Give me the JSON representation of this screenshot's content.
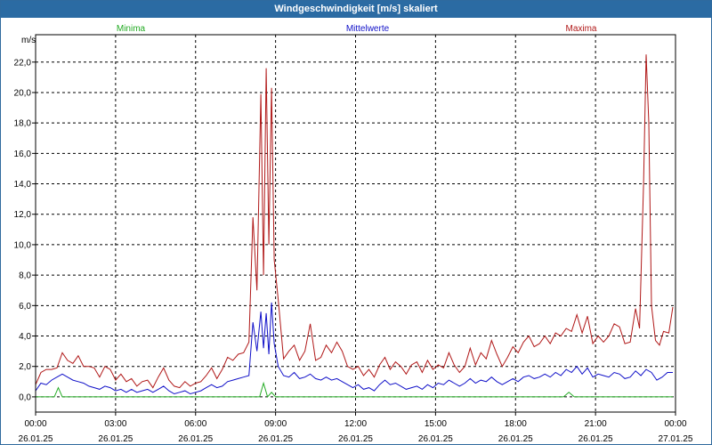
{
  "window": {
    "title": "Windgeschwindigkeit [m/s] skaliert"
  },
  "chart_data": {
    "type": "line",
    "title": "Windgeschwindigkeit [m/s] skaliert",
    "ylabel": "m/s",
    "xlabel": "",
    "ylim": [
      -1.0,
      23.8
    ],
    "xlim": [
      0,
      24
    ],
    "y_ticks": [
      "0,0",
      "2,0",
      "4,0",
      "6,0",
      "8,0",
      "10,0",
      "12,0",
      "14,0",
      "16,0",
      "18,0",
      "20,0",
      "22,0"
    ],
    "x_ticks": [
      {
        "time": "00:00",
        "date": "26.01.25"
      },
      {
        "time": "03:00",
        "date": "26.01.25"
      },
      {
        "time": "06:00",
        "date": "26.01.25"
      },
      {
        "time": "09:00",
        "date": "26.01.25"
      },
      {
        "time": "12:00",
        "date": "26.01.25"
      },
      {
        "time": "15:00",
        "date": "26.01.25"
      },
      {
        "time": "18:00",
        "date": "26.01.25"
      },
      {
        "time": "21:00",
        "date": "26.01.25"
      },
      {
        "time": "00:00",
        "date": "27.01.25"
      }
    ],
    "grid": true,
    "legend_position": "top",
    "colors": {
      "minima": "#22aa22",
      "mittel": "#1010c8",
      "maxima": "#b01818",
      "grid": "#000000"
    },
    "series": [
      {
        "name": "Maxima",
        "color": "#b01818",
        "points": [
          [
            0.0,
            0.8
          ],
          [
            0.2,
            1.6
          ],
          [
            0.4,
            1.8
          ],
          [
            0.6,
            1.8
          ],
          [
            0.8,
            1.9
          ],
          [
            1.0,
            2.9
          ],
          [
            1.2,
            2.4
          ],
          [
            1.4,
            2.2
          ],
          [
            1.6,
            2.7
          ],
          [
            1.8,
            2.0
          ],
          [
            2.0,
            2.0
          ],
          [
            2.2,
            1.9
          ],
          [
            2.4,
            1.3
          ],
          [
            2.6,
            2.0
          ],
          [
            2.8,
            1.8
          ],
          [
            3.0,
            1.1
          ],
          [
            3.2,
            1.5
          ],
          [
            3.4,
            1.0
          ],
          [
            3.6,
            1.2
          ],
          [
            3.8,
            0.7
          ],
          [
            4.0,
            1.0
          ],
          [
            4.2,
            1.1
          ],
          [
            4.4,
            0.6
          ],
          [
            4.6,
            1.3
          ],
          [
            4.8,
            1.9
          ],
          [
            5.0,
            1.1
          ],
          [
            5.2,
            0.7
          ],
          [
            5.4,
            0.6
          ],
          [
            5.6,
            1.0
          ],
          [
            5.8,
            0.7
          ],
          [
            6.0,
            0.9
          ],
          [
            6.2,
            1.0
          ],
          [
            6.4,
            1.4
          ],
          [
            6.6,
            1.9
          ],
          [
            6.8,
            1.2
          ],
          [
            7.0,
            1.8
          ],
          [
            7.2,
            2.6
          ],
          [
            7.4,
            2.4
          ],
          [
            7.6,
            2.8
          ],
          [
            7.8,
            2.9
          ],
          [
            8.0,
            3.6
          ],
          [
            8.15,
            11.8
          ],
          [
            8.3,
            7.0
          ],
          [
            8.45,
            19.9
          ],
          [
            8.55,
            8.0
          ],
          [
            8.65,
            21.6
          ],
          [
            8.75,
            10.0
          ],
          [
            8.85,
            20.3
          ],
          [
            8.95,
            9.0
          ],
          [
            9.1,
            6.4
          ],
          [
            9.3,
            2.5
          ],
          [
            9.5,
            3.0
          ],
          [
            9.7,
            3.4
          ],
          [
            9.9,
            2.4
          ],
          [
            10.1,
            3.0
          ],
          [
            10.3,
            4.8
          ],
          [
            10.5,
            2.4
          ],
          [
            10.7,
            2.6
          ],
          [
            10.9,
            3.4
          ],
          [
            11.1,
            2.9
          ],
          [
            11.3,
            3.6
          ],
          [
            11.5,
            3.0
          ],
          [
            11.7,
            2.0
          ],
          [
            11.9,
            1.8
          ],
          [
            12.1,
            2.0
          ],
          [
            12.3,
            1.4
          ],
          [
            12.5,
            1.8
          ],
          [
            12.7,
            1.3
          ],
          [
            12.9,
            2.1
          ],
          [
            13.1,
            2.6
          ],
          [
            13.3,
            1.8
          ],
          [
            13.5,
            2.3
          ],
          [
            13.7,
            2.0
          ],
          [
            13.9,
            1.5
          ],
          [
            14.1,
            2.1
          ],
          [
            14.3,
            2.3
          ],
          [
            14.5,
            1.6
          ],
          [
            14.7,
            2.4
          ],
          [
            14.9,
            1.8
          ],
          [
            15.1,
            2.1
          ],
          [
            15.3,
            1.9
          ],
          [
            15.5,
            2.9
          ],
          [
            15.7,
            2.1
          ],
          [
            15.9,
            1.6
          ],
          [
            16.1,
            2.0
          ],
          [
            16.3,
            3.2
          ],
          [
            16.5,
            2.1
          ],
          [
            16.7,
            2.9
          ],
          [
            16.9,
            2.5
          ],
          [
            17.1,
            3.7
          ],
          [
            17.3,
            2.8
          ],
          [
            17.5,
            2.0
          ],
          [
            17.7,
            2.6
          ],
          [
            17.9,
            3.3
          ],
          [
            18.1,
            2.9
          ],
          [
            18.3,
            3.6
          ],
          [
            18.5,
            4.0
          ],
          [
            18.7,
            3.3
          ],
          [
            18.9,
            3.5
          ],
          [
            19.1,
            4.0
          ],
          [
            19.3,
            3.5
          ],
          [
            19.5,
            4.2
          ],
          [
            19.7,
            4.0
          ],
          [
            19.9,
            4.5
          ],
          [
            20.1,
            4.3
          ],
          [
            20.3,
            5.4
          ],
          [
            20.5,
            4.2
          ],
          [
            20.7,
            5.3
          ],
          [
            20.9,
            3.5
          ],
          [
            21.1,
            4.0
          ],
          [
            21.3,
            3.6
          ],
          [
            21.5,
            4.0
          ],
          [
            21.7,
            4.8
          ],
          [
            21.9,
            4.6
          ],
          [
            22.1,
            3.5
          ],
          [
            22.3,
            3.6
          ],
          [
            22.5,
            5.8
          ],
          [
            22.65,
            4.5
          ],
          [
            22.8,
            14.0
          ],
          [
            22.9,
            22.5
          ],
          [
            23.0,
            18.0
          ],
          [
            23.1,
            6.0
          ],
          [
            23.25,
            3.7
          ],
          [
            23.4,
            3.4
          ],
          [
            23.55,
            4.3
          ],
          [
            23.75,
            4.2
          ],
          [
            23.9,
            5.9
          ]
        ]
      },
      {
        "name": "Mittelwerte",
        "color": "#1010c8",
        "points": [
          [
            0.0,
            0.4
          ],
          [
            0.2,
            0.9
          ],
          [
            0.4,
            0.8
          ],
          [
            0.6,
            1.1
          ],
          [
            0.8,
            1.3
          ],
          [
            1.0,
            1.5
          ],
          [
            1.2,
            1.3
          ],
          [
            1.4,
            1.1
          ],
          [
            1.6,
            1.0
          ],
          [
            1.8,
            0.9
          ],
          [
            2.0,
            0.7
          ],
          [
            2.2,
            0.6
          ],
          [
            2.4,
            0.5
          ],
          [
            2.6,
            0.7
          ],
          [
            2.8,
            0.6
          ],
          [
            3.0,
            0.4
          ],
          [
            3.2,
            0.5
          ],
          [
            3.4,
            0.3
          ],
          [
            3.6,
            0.5
          ],
          [
            3.8,
            0.3
          ],
          [
            4.0,
            0.4
          ],
          [
            4.2,
            0.5
          ],
          [
            4.4,
            0.3
          ],
          [
            4.6,
            0.5
          ],
          [
            4.8,
            0.7
          ],
          [
            5.0,
            0.4
          ],
          [
            5.2,
            0.2
          ],
          [
            5.4,
            0.3
          ],
          [
            5.6,
            0.4
          ],
          [
            5.8,
            0.2
          ],
          [
            6.0,
            0.3
          ],
          [
            6.2,
            0.4
          ],
          [
            6.4,
            0.6
          ],
          [
            6.6,
            0.8
          ],
          [
            6.8,
            0.6
          ],
          [
            7.0,
            0.7
          ],
          [
            7.2,
            1.0
          ],
          [
            7.4,
            1.1
          ],
          [
            7.6,
            1.2
          ],
          [
            7.8,
            1.3
          ],
          [
            8.0,
            1.4
          ],
          [
            8.15,
            4.9
          ],
          [
            8.3,
            3.0
          ],
          [
            8.45,
            5.6
          ],
          [
            8.55,
            3.2
          ],
          [
            8.65,
            5.5
          ],
          [
            8.75,
            2.8
          ],
          [
            8.85,
            6.2
          ],
          [
            8.95,
            3.5
          ],
          [
            9.1,
            2.0
          ],
          [
            9.3,
            1.4
          ],
          [
            9.5,
            1.3
          ],
          [
            9.7,
            1.6
          ],
          [
            9.9,
            1.2
          ],
          [
            10.1,
            1.3
          ],
          [
            10.3,
            1.5
          ],
          [
            10.5,
            1.2
          ],
          [
            10.7,
            1.1
          ],
          [
            10.9,
            1.3
          ],
          [
            11.1,
            1.1
          ],
          [
            11.3,
            1.2
          ],
          [
            11.5,
            1.0
          ],
          [
            11.7,
            0.8
          ],
          [
            11.9,
            0.6
          ],
          [
            12.1,
            0.8
          ],
          [
            12.3,
            0.5
          ],
          [
            12.5,
            0.6
          ],
          [
            12.7,
            0.4
          ],
          [
            12.9,
            0.8
          ],
          [
            13.1,
            1.1
          ],
          [
            13.3,
            0.8
          ],
          [
            13.5,
            0.9
          ],
          [
            13.7,
            0.7
          ],
          [
            13.9,
            0.5
          ],
          [
            14.1,
            0.6
          ],
          [
            14.3,
            0.7
          ],
          [
            14.5,
            0.5
          ],
          [
            14.7,
            0.8
          ],
          [
            14.9,
            0.6
          ],
          [
            15.1,
            0.9
          ],
          [
            15.3,
            0.8
          ],
          [
            15.5,
            1.1
          ],
          [
            15.7,
            0.9
          ],
          [
            15.9,
            0.7
          ],
          [
            16.1,
            0.9
          ],
          [
            16.3,
            1.2
          ],
          [
            16.5,
            0.9
          ],
          [
            16.7,
            1.1
          ],
          [
            16.9,
            1.0
          ],
          [
            17.1,
            1.3
          ],
          [
            17.3,
            1.0
          ],
          [
            17.5,
            0.8
          ],
          [
            17.7,
            1.0
          ],
          [
            17.9,
            1.2
          ],
          [
            18.1,
            1.0
          ],
          [
            18.3,
            1.3
          ],
          [
            18.5,
            1.4
          ],
          [
            18.7,
            1.2
          ],
          [
            18.9,
            1.3
          ],
          [
            19.1,
            1.5
          ],
          [
            19.3,
            1.3
          ],
          [
            19.5,
            1.6
          ],
          [
            19.7,
            1.4
          ],
          [
            19.9,
            1.8
          ],
          [
            20.1,
            1.6
          ],
          [
            20.3,
            2.0
          ],
          [
            20.5,
            1.5
          ],
          [
            20.7,
            1.9
          ],
          [
            20.9,
            1.3
          ],
          [
            21.1,
            1.5
          ],
          [
            21.3,
            1.4
          ],
          [
            21.5,
            1.3
          ],
          [
            21.7,
            1.6
          ],
          [
            21.9,
            1.5
          ],
          [
            22.1,
            1.2
          ],
          [
            22.3,
            1.3
          ],
          [
            22.5,
            1.7
          ],
          [
            22.7,
            1.4
          ],
          [
            22.9,
            1.8
          ],
          [
            23.1,
            1.6
          ],
          [
            23.3,
            1.1
          ],
          [
            23.5,
            1.3
          ],
          [
            23.7,
            1.6
          ],
          [
            23.9,
            1.6
          ]
        ]
      },
      {
        "name": "Minima",
        "color": "#22aa22",
        "points": [
          [
            0.0,
            0.0
          ],
          [
            0.7,
            0.0
          ],
          [
            0.85,
            0.6
          ],
          [
            1.0,
            0.0
          ],
          [
            8.4,
            0.0
          ],
          [
            8.55,
            0.9
          ],
          [
            8.7,
            0.0
          ],
          [
            8.85,
            0.3
          ],
          [
            9.0,
            0.0
          ],
          [
            19.8,
            0.0
          ],
          [
            20.0,
            0.3
          ],
          [
            20.2,
            0.0
          ],
          [
            23.9,
            0.0
          ]
        ]
      }
    ]
  }
}
